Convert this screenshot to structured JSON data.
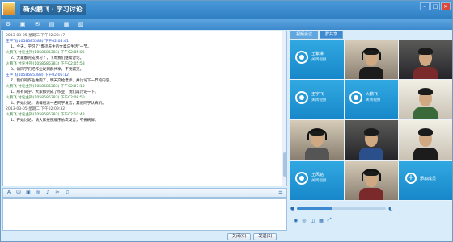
{
  "window": {
    "title": "新火鹏飞 · 学习讨论"
  },
  "toolbar": {
    "icons": [
      "settings-icon",
      "folder-icon",
      "mail-icon",
      "chat-icon",
      "notes-icon",
      "file-icon"
    ]
  },
  "chat": {
    "messages": [
      {
        "head": "2013-03-05 星期二 下午02:23:17",
        "body": "",
        "type": "notice"
      },
      {
        "head": "王宇飞(1058585383)  下午02:04:41",
        "body": "1、今天，学习了“鲁迅先生的文章与生活”一节。",
        "type": "msg"
      },
      {
        "head": "火鹏飞 讨论主持(1058585383) 下午02:05:06",
        "body": "2、大家都完成预习了，下周我们继续讨论。",
        "type": "msg"
      },
      {
        "head": "火鹏飞 讨论主持(1058585383) 下午02:05:58",
        "body": "3、请同学们把作业发到群共享，不要漏交。",
        "type": "msg"
      },
      {
        "head": "王宇飞(1058585383)  下午02:06:12",
        "body": "7、我们的作业做完了，明天交给老师，并讨论下一节的内容。",
        "type": "msg"
      },
      {
        "head": "火鹏飞 讨论主持(1058585383) 下午02:07:10",
        "body": "1、所有同学，大家都完成了作业，我们再讨论一下。",
        "type": "msg"
      },
      {
        "head": "火鹏飞 讨论主持(1058585383) 下午02:08:50",
        "body": "4、开始讨论：请每组派一名同学发言，其他同学认真听。",
        "type": "msg"
      },
      {
        "head": "2013-03-05 星期二 下午02:09:32",
        "body": "",
        "type": "notice"
      },
      {
        "head": "火鹏飞 讨论主持(1058585383) 下午02:10:48",
        "body": "1、开始讨论，请大家按照顺序依次发言，不要刷屏。",
        "type": "msg"
      }
    ],
    "input_value": ""
  },
  "buttons": {
    "close": "关闭(C)",
    "send": "发送(S)"
  },
  "tabs": [
    {
      "label": "视频会议"
    },
    {
      "label": "群共享"
    }
  ],
  "participants": [
    {
      "kind": "placeholder",
      "name": "王紫琳",
      "status": "关闭视频"
    },
    {
      "kind": "video"
    },
    {
      "kind": "video"
    },
    {
      "kind": "placeholder",
      "name": "王宇飞",
      "status": "关闭视频"
    },
    {
      "kind": "placeholder",
      "name": "火鹏飞",
      "status": "关闭视频"
    },
    {
      "kind": "video"
    },
    {
      "kind": "video"
    },
    {
      "kind": "video"
    },
    {
      "kind": "video"
    },
    {
      "kind": "placeholder",
      "name": "王风铭",
      "status": "关闭视频"
    },
    {
      "kind": "video"
    },
    {
      "kind": "add",
      "label": "添加成员"
    }
  ],
  "volume": {
    "level": 0.4
  },
  "colors": {
    "accent": "#2f7fc4",
    "tile": "#1787c9"
  }
}
